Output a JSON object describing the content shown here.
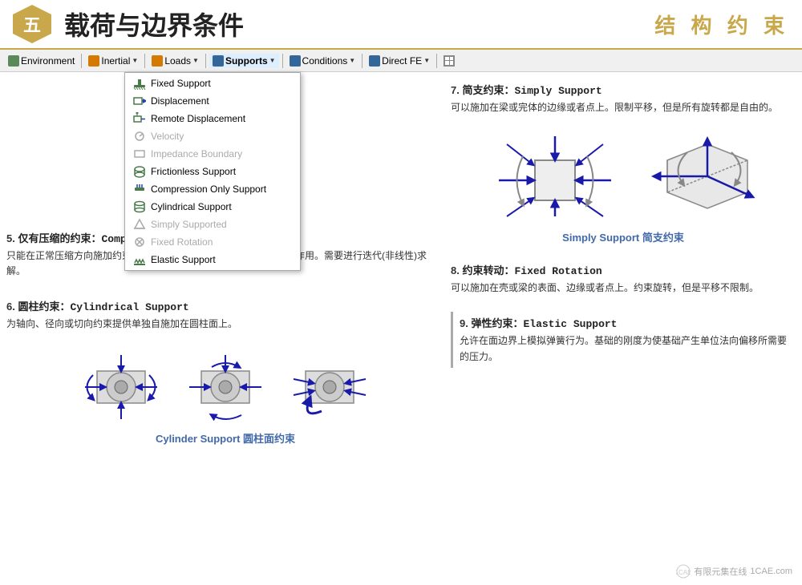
{
  "header": {
    "badge": "五",
    "title": "载荷与边界条件",
    "subtitle": "结 构 约 束"
  },
  "toolbar": {
    "items": [
      {
        "label": "Environment",
        "icon": "env-icon",
        "has_arrow": false
      },
      {
        "label": "Inertial",
        "icon": "inertial-icon",
        "has_arrow": true
      },
      {
        "label": "Loads",
        "icon": "loads-icon",
        "has_arrow": true
      },
      {
        "label": "Supports",
        "icon": "supports-icon",
        "has_arrow": true,
        "active": true
      },
      {
        "label": "Conditions",
        "icon": "conditions-icon",
        "has_arrow": true
      },
      {
        "label": "Direct FE",
        "icon": "directfe-icon",
        "has_arrow": true
      }
    ]
  },
  "dropdown": {
    "items": [
      {
        "label": "Fixed Support",
        "enabled": true
      },
      {
        "label": "Displacement",
        "enabled": true
      },
      {
        "label": "Remote Displacement",
        "enabled": true
      },
      {
        "label": "Velocity",
        "enabled": false
      },
      {
        "label": "Impedance Boundary",
        "enabled": false
      },
      {
        "label": "Frictionless Support",
        "enabled": true
      },
      {
        "label": "Compression Only Support",
        "enabled": true
      },
      {
        "label": "Cylindrical Support",
        "enabled": true
      },
      {
        "label": "Simply Supported",
        "enabled": false
      },
      {
        "label": "Fixed Rotation",
        "enabled": false
      },
      {
        "label": "Elastic Support",
        "enabled": true
      }
    ]
  },
  "sections": {
    "simply_support": {
      "num": "7.",
      "title": "简支约束：Simply  Support",
      "body": "可以施加在梁或完体的边缘或者点上。限制平移，但是所有旋转都是自由的。",
      "label": "Simply Support 简支约束"
    },
    "compression": {
      "num": "5.",
      "title": "仅有压缩的约束：Compression  Only  Support",
      "body": "只能在正常压缩方向施加约束。可以模拟圆柱面上受销钉、螺栓等的作用。需要进行迭代(非线性)求解。"
    },
    "cylindrical": {
      "num": "6.",
      "title": "圆柱约束：Cylindrical  Support",
      "body": "为轴向、径向或切向约束提供单独自施加在圆柱面上。",
      "label": "Cylinder Support 圆柱面约束"
    },
    "fixed_rotation": {
      "num": "8.",
      "title": "约束转动：Fixed  Rotation",
      "body": "可以施加在壳或梁的表面、边缘或者点上。约束旋转，但是平移不限制。"
    },
    "elastic": {
      "num": "9.",
      "title": "弹性约束：Elastic  Support",
      "body": "允许在面边界上模拟弹簧行为。基础的刚度为使基础产生单位法向偏移所需要的压力。"
    }
  },
  "watermark": {
    "site": "1CAE.com",
    "label": "有限元集在线"
  }
}
